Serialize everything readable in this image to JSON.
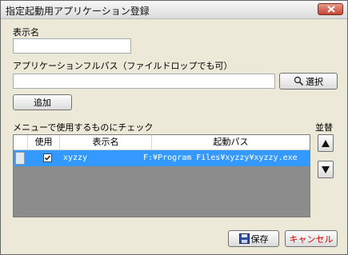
{
  "window": {
    "title": "指定起動用アプリケーション登録"
  },
  "form": {
    "display_name_label": "表示名",
    "display_name_value": "",
    "app_path_label": "アプリケーションフルパス（ファイルドロップでも可）",
    "app_path_value": "",
    "select_label": "選択",
    "add_label": "追加"
  },
  "list": {
    "section_label": "メニューで使用するものにチェック",
    "sort_label": "並替",
    "columns": {
      "use": "使用",
      "name": "表示名",
      "path": "起動パス"
    },
    "rows": [
      {
        "checked": true,
        "name": "xyzzy",
        "path": "F:¥Program Files¥xyzzy¥xyzzy.exe"
      }
    ]
  },
  "footer": {
    "save_label": "保存",
    "cancel_label": "キャンセル"
  },
  "colors": {
    "selection": "#3399ff",
    "list_bg": "#8c8c8c",
    "cancel_text": "#cc0000"
  },
  "icons": [
    "close-icon",
    "magnifier-icon",
    "arrow-up-icon",
    "arrow-down-icon",
    "save-icon"
  ]
}
